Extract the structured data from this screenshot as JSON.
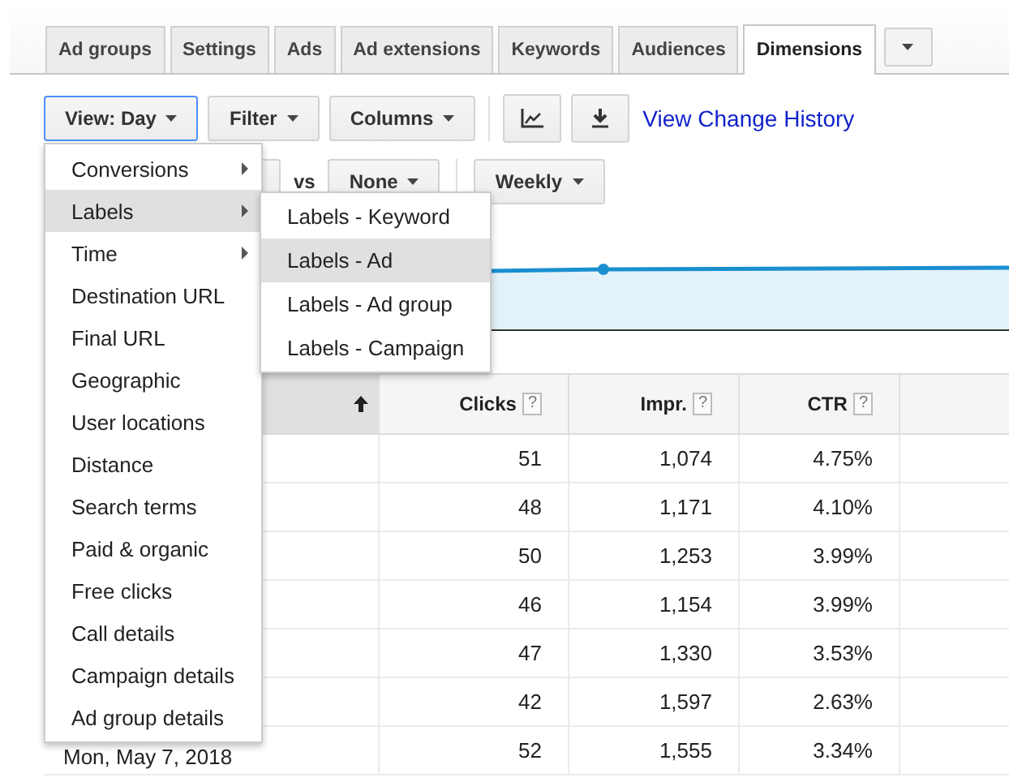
{
  "tabs": [
    {
      "label": "Ad groups",
      "selected": false
    },
    {
      "label": "Settings",
      "selected": false
    },
    {
      "label": "Ads",
      "selected": false
    },
    {
      "label": "Ad extensions",
      "selected": false
    },
    {
      "label": "Keywords",
      "selected": false
    },
    {
      "label": "Audiences",
      "selected": false
    },
    {
      "label": "Dimensions",
      "selected": true
    }
  ],
  "toolbar": {
    "buttons": [
      {
        "label": "View: Day",
        "selected": true
      },
      {
        "label": "Filter",
        "selected": false
      },
      {
        "label": "Columns",
        "selected": false
      }
    ],
    "link": "View Change History"
  },
  "compare": {
    "vs": "vs",
    "compare_button": "None",
    "interval_button": "Weekly"
  },
  "table": {
    "columns": [
      {
        "kind": "sort",
        "sort_ascending": true
      },
      {
        "kind": "metric",
        "label": "Clicks",
        "help": "?"
      },
      {
        "kind": "metric",
        "label": "Impr.",
        "help": "?"
      },
      {
        "kind": "metric",
        "label": "CTR",
        "help": "?"
      }
    ],
    "rows": [
      {
        "clicks": "51",
        "impr": "1,074",
        "ctr": "4.75%"
      },
      {
        "clicks": "48",
        "impr": "1,171",
        "ctr": "4.10%"
      },
      {
        "clicks": "50",
        "impr": "1,253",
        "ctr": "3.99%"
      },
      {
        "clicks": "46",
        "impr": "1,154",
        "ctr": "3.99%"
      },
      {
        "clicks": "47",
        "impr": "1,330",
        "ctr": "3.53%"
      },
      {
        "clicks": "42",
        "impr": "1,597",
        "ctr": "2.63%"
      },
      {
        "date": "Mon, May 7, 2018",
        "clicks": "52",
        "impr": "1,555",
        "ctr": "3.34%"
      }
    ]
  },
  "view_menu": {
    "items": [
      {
        "label": "Conversions",
        "submenu": true,
        "selected": false
      },
      {
        "label": "Labels",
        "submenu": true,
        "selected": true
      },
      {
        "label": "Time",
        "submenu": true,
        "selected": false
      },
      {
        "label": "Destination URL",
        "submenu": false,
        "selected": false
      },
      {
        "label": "Final URL",
        "submenu": false,
        "selected": false
      },
      {
        "label": "Geographic",
        "submenu": false,
        "selected": false
      },
      {
        "label": "User locations",
        "submenu": false,
        "selected": false
      },
      {
        "label": "Distance",
        "submenu": false,
        "selected": false
      },
      {
        "label": "Search terms",
        "submenu": false,
        "selected": false
      },
      {
        "label": "Paid & organic",
        "submenu": false,
        "selected": false
      },
      {
        "label": "Free clicks",
        "submenu": false,
        "selected": false
      },
      {
        "label": "Call details",
        "submenu": false,
        "selected": false
      },
      {
        "label": "Campaign details",
        "submenu": false,
        "selected": false
      },
      {
        "label": "Ad group details",
        "submenu": false,
        "selected": false
      }
    ]
  },
  "labels_submenu": {
    "items": [
      {
        "label": "Labels - Keyword",
        "selected": false
      },
      {
        "label": "Labels - Ad",
        "selected": true
      },
      {
        "label": "Labels - Ad group",
        "selected": false
      },
      {
        "label": "Labels - Campaign",
        "selected": false
      }
    ]
  }
}
